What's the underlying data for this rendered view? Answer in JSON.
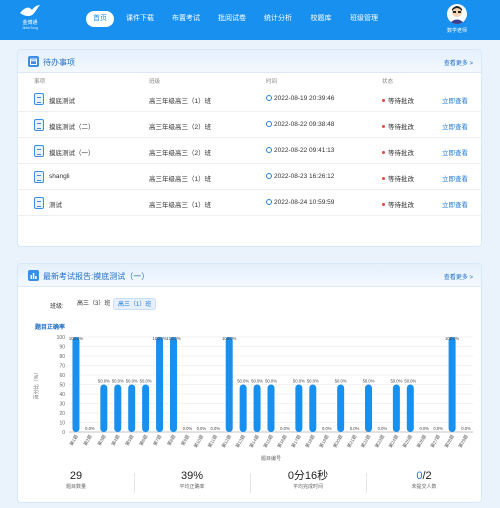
{
  "header": {
    "logo": {
      "name": "金博通",
      "sub": "JinboTong"
    },
    "nav": [
      {
        "label": "首页",
        "active": true
      },
      {
        "label": "课件下载",
        "active": false
      },
      {
        "label": "布置考试",
        "active": false
      },
      {
        "label": "批阅试卷",
        "active": false
      },
      {
        "label": "统计分析",
        "active": false
      },
      {
        "label": "校题库",
        "active": false
      },
      {
        "label": "班级管理",
        "active": false
      }
    ],
    "user": {
      "name": "数学老师"
    }
  },
  "todo": {
    "title": "待办事项",
    "more": "查看更多 >",
    "columns": {
      "task": "事项",
      "class": "班级",
      "time": "时间",
      "status": "状态"
    },
    "rows": [
      {
        "task": "摸底测试",
        "class": "高三年级高三（1）班",
        "time": "2022-08-19 20:39:46",
        "status": "等待批改",
        "action": "立即查看"
      },
      {
        "task": "摸底测试（二）",
        "class": "高三年级高三（2）班",
        "time": "2022-08-22 09:38:48",
        "status": "等待批改",
        "action": "立即查看"
      },
      {
        "task": "摸底测试（一）",
        "class": "高三年级高三（2）班",
        "time": "2022-08-22 09:41:13",
        "status": "等待批改",
        "action": "立即查看"
      },
      {
        "task": "shangli",
        "class": "高三年级高三（1）班",
        "time": "2022-08-23 16:26:12",
        "status": "等待批改",
        "action": "立即查看"
      },
      {
        "task": "测试",
        "class": "高三年级高三（1）班",
        "time": "2022-08-24 10:59:59",
        "status": "等待批改",
        "action": "立即查看"
      }
    ]
  },
  "report": {
    "title": "最新考试报告:摸底测试（一）",
    "more": "查看更多 >",
    "class_label": "班级:",
    "class_options": [
      {
        "label": "高三（3）班",
        "active": false
      },
      {
        "label": "高三（1）班",
        "active": true
      }
    ],
    "chart_title": "题目正确率",
    "stats": [
      {
        "value": "29",
        "label": "题目数量"
      },
      {
        "value": "39%",
        "label": "平均正确率"
      },
      {
        "value": "0分16秒",
        "label": "平均完成时间"
      },
      {
        "value_accent": "0",
        "value_rest": "/2",
        "label": "未提交人数"
      }
    ]
  },
  "chart_data": {
    "type": "bar",
    "title": "题目正确率",
    "xlabel": "题目编号",
    "ylabel": "百分比（%）",
    "ylim": [
      0,
      100
    ],
    "yticks": [
      0,
      10,
      20,
      30,
      40,
      50,
      60,
      70,
      80,
      90,
      100
    ],
    "categories": [
      "第1题",
      "第2题",
      "第3题",
      "第4题",
      "第5题",
      "第6题",
      "第7题",
      "第8题",
      "第9题",
      "第10题",
      "第11题",
      "第12题",
      "第13题",
      "第14题",
      "第15题",
      "第16题",
      "第17题",
      "第18题",
      "第19题",
      "第20题",
      "第21题",
      "第22题",
      "第23题",
      "第24题",
      "第25题",
      "第26题",
      "第27题",
      "第28题",
      "第29题"
    ],
    "values": [
      100,
      0,
      50,
      50,
      50,
      50,
      100,
      100,
      0,
      0,
      0,
      100,
      50,
      50,
      50,
      0,
      50,
      50,
      0,
      50,
      0,
      50,
      0,
      50,
      50,
      0,
      0,
      100,
      0
    ],
    "data_labels": [
      "100.0%",
      "0.0%",
      "50.0%",
      "50.0%",
      "50.0%",
      "50.0%",
      "100.0%",
      "100.0%",
      "0.0%",
      "0.0%",
      "0.0%",
      "100.0%",
      "50.0%",
      "50.0%",
      "50.0%",
      "0.0%",
      "50.0%",
      "50.0%",
      "0.0%",
      "50.0%",
      "0.0%",
      "50.0%",
      "0.0%",
      "50.0%",
      "50.0%",
      "0.0%",
      "0.0%",
      "100.0%",
      "0.0%"
    ],
    "bar_color": "#1890f0",
    "grid": true
  }
}
